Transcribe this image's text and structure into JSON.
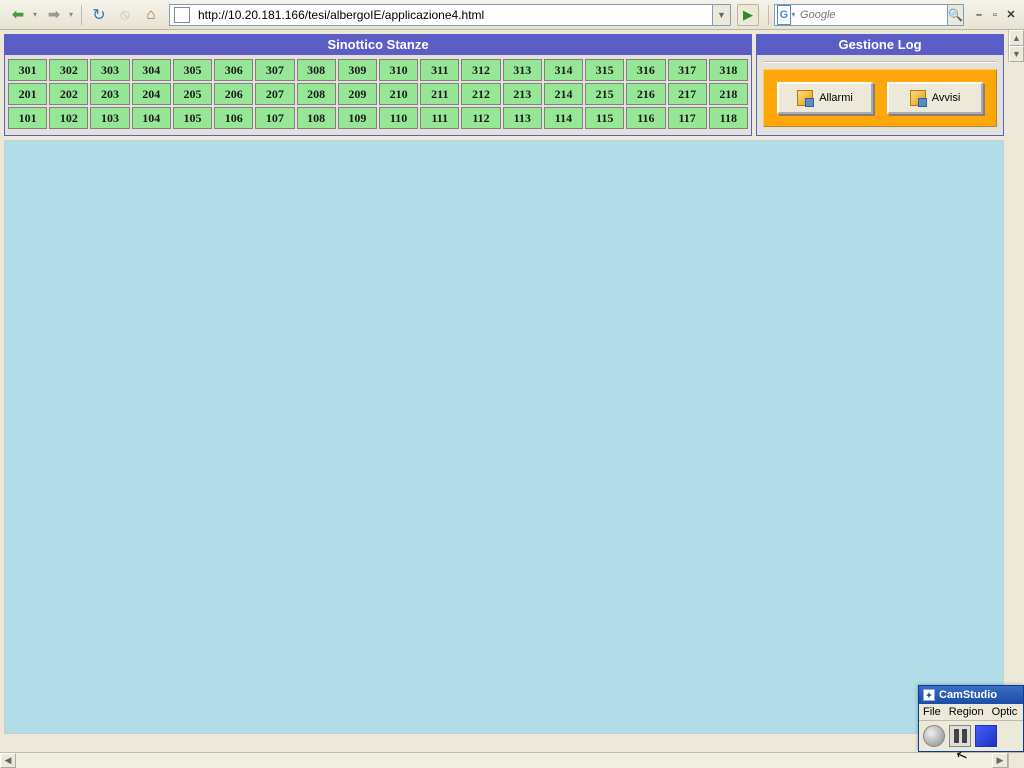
{
  "toolbar": {
    "url": "http://10.20.181.166/tesi/albergoIE/applicazione4.html",
    "search_placeholder": "Google"
  },
  "panels": {
    "rooms_title": "Sinottico Stanze",
    "log_title": "Gestione Log",
    "allarmi_label": "Allarmi",
    "avvisi_label": "Avvisi"
  },
  "rooms": [
    [
      "301",
      "302",
      "303",
      "304",
      "305",
      "306",
      "307",
      "308",
      "309",
      "310",
      "311",
      "312",
      "313",
      "314",
      "315",
      "316",
      "317",
      "318"
    ],
    [
      "201",
      "202",
      "203",
      "204",
      "205",
      "206",
      "207",
      "208",
      "209",
      "210",
      "211",
      "212",
      "213",
      "214",
      "215",
      "216",
      "217",
      "218"
    ],
    [
      "101",
      "102",
      "103",
      "104",
      "105",
      "106",
      "107",
      "108",
      "109",
      "110",
      "111",
      "112",
      "113",
      "114",
      "115",
      "116",
      "117",
      "118"
    ]
  ],
  "camstudio": {
    "title": "CamStudio",
    "menu_file": "File",
    "menu_region": "Region",
    "menu_options": "Optic"
  }
}
